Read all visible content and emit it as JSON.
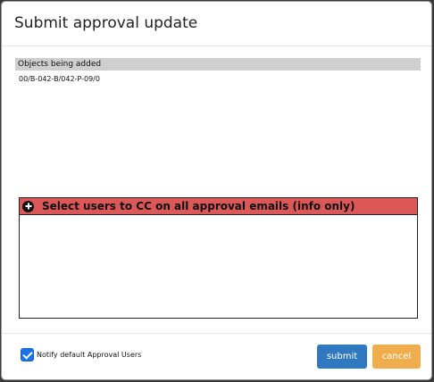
{
  "dialog": {
    "title": "Submit approval update"
  },
  "objects": {
    "header": "Objects being added",
    "items": [
      "00/B-042-B/042-P-09/0"
    ]
  },
  "cc_panel": {
    "title": "Select users to CC on all approval emails (info only)",
    "icon": "plus-circle-icon",
    "header_color": "#dc5757"
  },
  "footer": {
    "notify_label": "Notify default Approval Users",
    "notify_checked": true,
    "submit_label": "submit",
    "cancel_label": "cancel"
  },
  "colors": {
    "submit": "#3079c0",
    "cancel": "#f0ad4e",
    "checkbox": "#1a73e8"
  }
}
